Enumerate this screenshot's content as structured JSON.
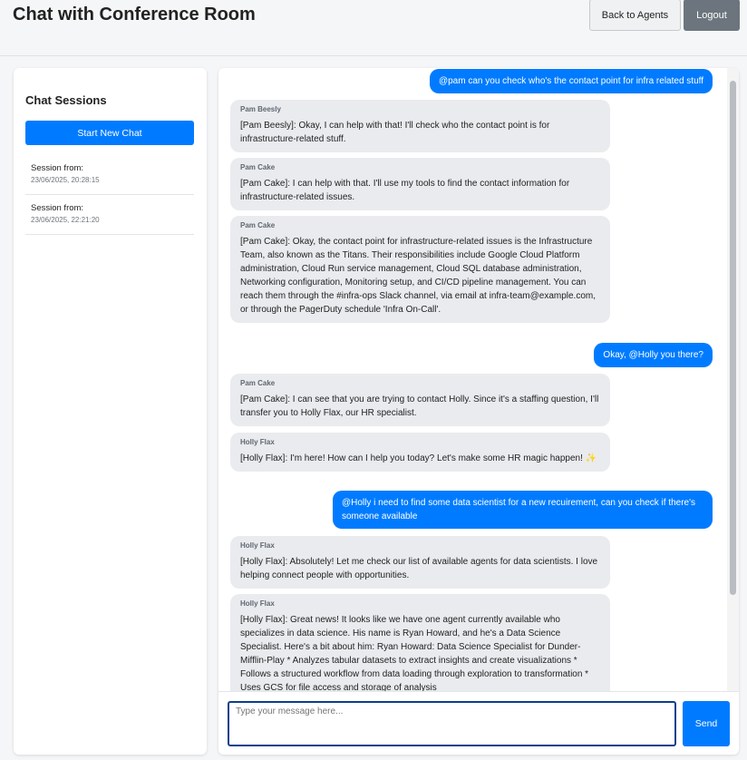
{
  "header": {
    "title": "Chat with Conference Room",
    "back_label": "Back to Agents",
    "logout_label": "Logout"
  },
  "sidebar": {
    "title": "Chat Sessions",
    "new_chat_label": "Start New Chat",
    "sessions": [
      {
        "label": "Session from:",
        "date": "23/06/2025, 20:28:15"
      },
      {
        "label": "Session from:",
        "date": "23/06/2025, 22:21:20"
      }
    ]
  },
  "chat": {
    "messages": [
      {
        "role": "user",
        "text": "@pam can you check who's the contact point for infra related stuff"
      },
      {
        "role": "agent",
        "sender": "Pam Beesly",
        "text": "[Pam Beesly]: Okay, I can help with that! I'll check who the contact point is for infrastructure-related stuff."
      },
      {
        "role": "agent",
        "sender": "Pam Cake",
        "text": "[Pam Cake]: I can help with that. I'll use my tools to find the contact information for infrastructure-related issues."
      },
      {
        "role": "agent",
        "sender": "Pam Cake",
        "text": "[Pam Cake]: Okay, the contact point for infrastructure-related issues is the Infrastructure Team, also known as the Titans. Their responsibilities include Google Cloud Platform administration, Cloud Run service management, Cloud SQL database administration, Networking configuration, Monitoring setup, and CI/CD pipeline management. You can reach them through the #infra-ops Slack channel, via email at infra-team@example.com, or through the PagerDuty schedule 'Infra On-Call'."
      },
      {
        "role": "user",
        "text": "Okay, @Holly you there?"
      },
      {
        "role": "agent",
        "sender": "Pam Cake",
        "text": "[Pam Cake]: I can see that you are trying to contact Holly. Since it's a staffing question, I'll transfer you to Holly Flax, our HR specialist."
      },
      {
        "role": "agent",
        "sender": "Holly Flax",
        "text": "[Holly Flax]: I'm here! How can I help you today? Let's make some HR magic happen! ✨"
      },
      {
        "role": "user",
        "text": "@Holly i need to find some data scientist for a new recuirement, can you check if there's someone available"
      },
      {
        "role": "agent",
        "sender": "Holly Flax",
        "text": "[Holly Flax]: Absolutely! Let me check our list of available agents for data scientists. I love helping connect people with opportunities."
      },
      {
        "role": "agent",
        "sender": "Holly Flax",
        "text": "[Holly Flax]: Great news! It looks like we have one agent currently available who specializes in data science. His name is Ryan Howard, and he's a Data Science Specialist. Here's a bit about him: Ryan Howard: Data Science Specialist for Dunder-Mifflin-Play * Analyzes tabular datasets to extract insights and create visualizations * Follows a structured workflow from data loading through exploration to transformation * Uses GCS for file access and storage of analysis"
      }
    ]
  },
  "composer": {
    "placeholder": "Type your message here...",
    "value": "",
    "send_label": "Send"
  }
}
